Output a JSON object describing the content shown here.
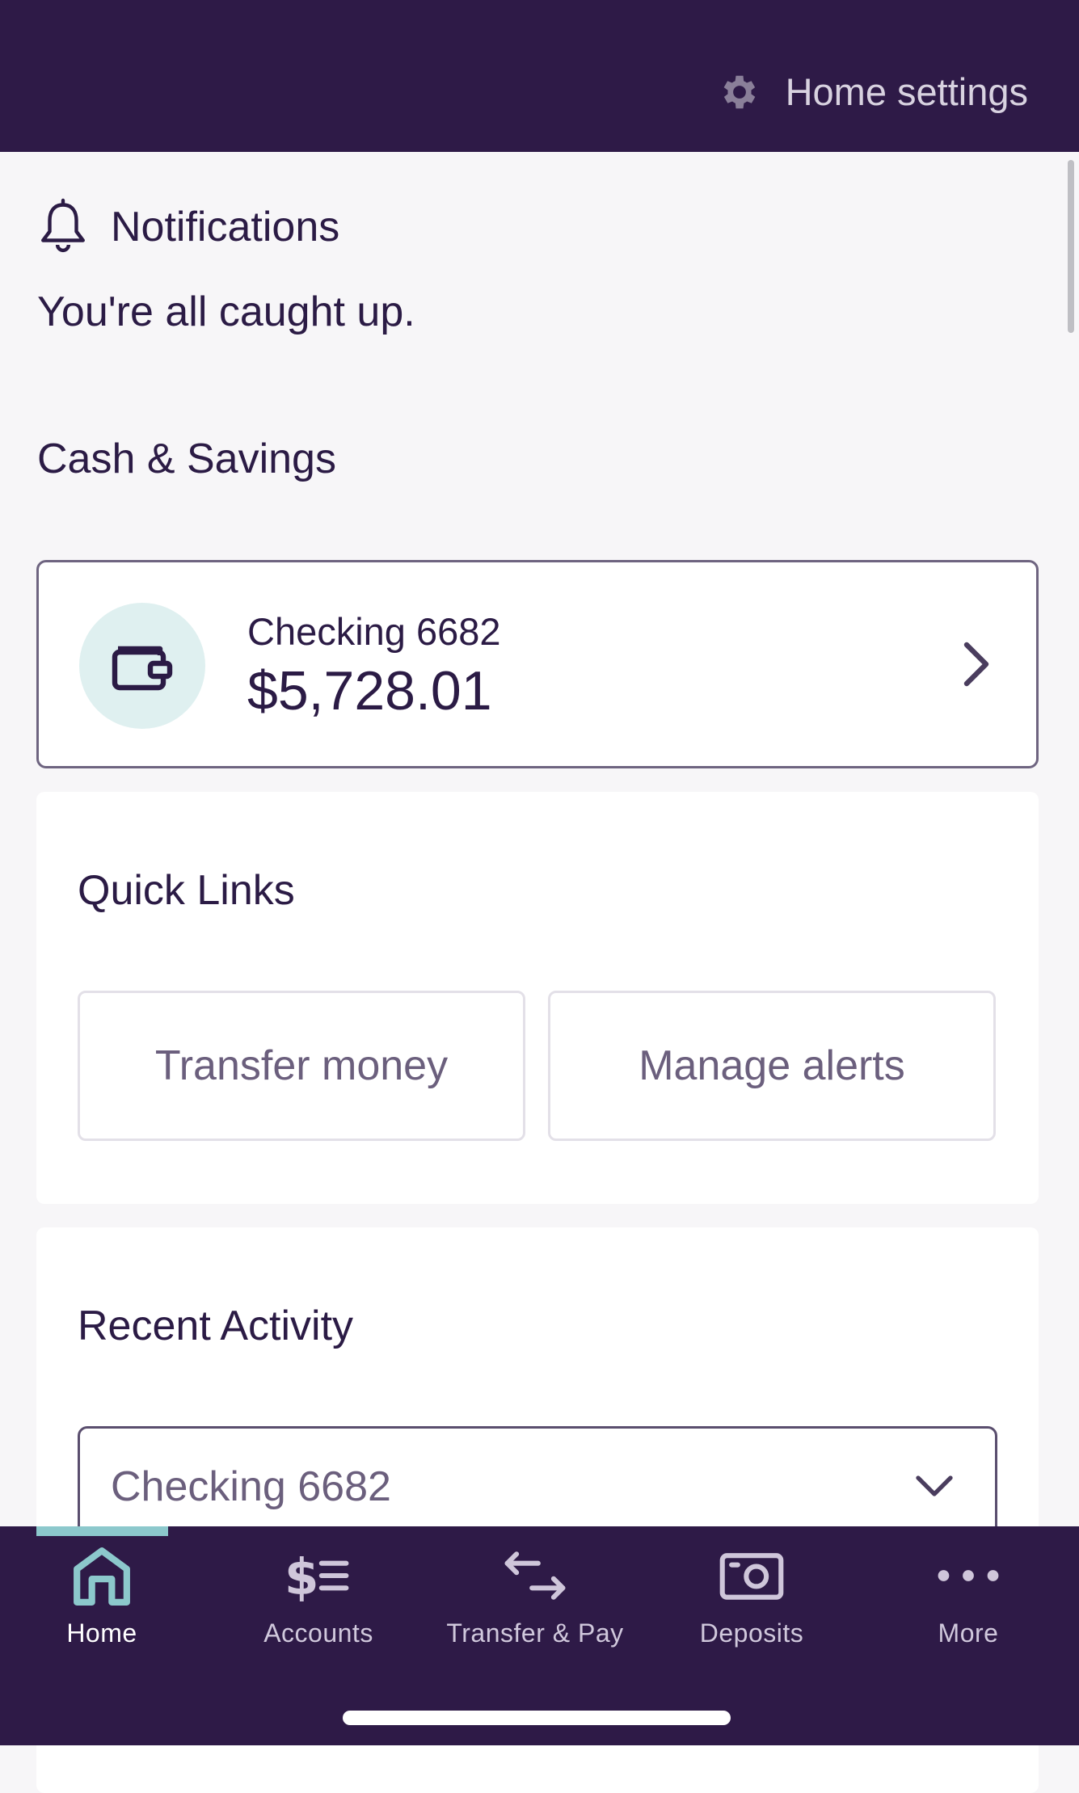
{
  "header": {
    "settings_label": "Home settings",
    "settings_icon": "gear-icon"
  },
  "notifications": {
    "title": "Notifications",
    "icon": "bell-icon",
    "message": "You're all caught up."
  },
  "cash_savings": {
    "title": "Cash & Savings",
    "account": {
      "name": "Checking 6682",
      "balance": "$5,728.01",
      "icon": "wallet-icon"
    }
  },
  "quick_links": {
    "title": "Quick Links",
    "buttons": [
      {
        "label": "Transfer money"
      },
      {
        "label": "Manage alerts"
      }
    ]
  },
  "recent_activity": {
    "title": "Recent Activity",
    "selected_account": "Checking 6682"
  },
  "bottom_nav": {
    "active": "Home",
    "items": [
      {
        "label": "Home",
        "icon": "home-icon"
      },
      {
        "label": "Accounts",
        "icon": "accounts-icon"
      },
      {
        "label": "Transfer & Pay",
        "icon": "transfer-icon"
      },
      {
        "label": "Deposits",
        "icon": "camera-icon"
      },
      {
        "label": "More",
        "icon": "more-icon"
      }
    ]
  },
  "colors": {
    "header_bg": "#2e1a47",
    "accent": "#8cc8cc",
    "text": "#2b1b45",
    "wallet_bg": "#dff0f0"
  }
}
